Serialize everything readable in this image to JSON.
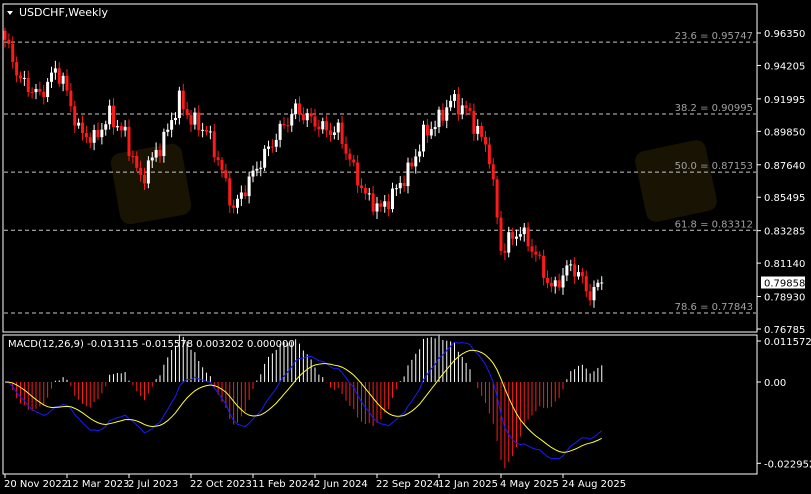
{
  "header": {
    "symbol_timeframe": "USDCHF,Weekly"
  },
  "colors": {
    "bull": "#ffffff",
    "bear": "#ff1a1a",
    "macd_line": "#1a1aff",
    "signal_line": "#ffff33",
    "grid": "#c8c8c8",
    "fib_text": "#a0a0a0"
  },
  "price_axis": {
    "labels": [
      "0.96350",
      "0.94205",
      "0.91995",
      "0.89850",
      "0.87640",
      "0.85495",
      "0.83285",
      "0.81140",
      "0.78930",
      "0.76785"
    ],
    "values": [
      0.9635,
      0.94205,
      0.91995,
      0.8985,
      0.8764,
      0.85495,
      0.83285,
      0.8114,
      0.7893,
      0.76785
    ],
    "current_price": "0.79858"
  },
  "fibonacci": [
    {
      "label": "23.6 = 0.95747",
      "value": 0.95747
    },
    {
      "label": "38.2 = 0.90995",
      "value": 0.90995
    },
    {
      "label": "50.0 = 0.87153",
      "value": 0.87153
    },
    {
      "label": "61.8 = 0.83312",
      "value": 0.83312
    },
    {
      "label": "78.6 = 0.77843",
      "value": 0.77843
    }
  ],
  "macd": {
    "title": "MACD(12,26,9) -0.013115 -0.015578 0.003202 0.000000",
    "axis_labels": [
      "0.011572",
      "0.00",
      "-0.022952"
    ],
    "axis_values": [
      0.011572,
      0,
      -0.022952
    ]
  },
  "time_axis": [
    "20 Nov 2022",
    "12 Mar 2023",
    "2 Jul 2023",
    "22 Oct 2023",
    "11 Feb 2024",
    "2 Jun 2024",
    "22 Sep 2024",
    "12 Jan 2025",
    "4 May 2025",
    "24 Aug 2025"
  ],
  "chart_data": {
    "type": "candlestick",
    "title": "USDCHF,Weekly",
    "ylim": [
      0.76785,
      0.9635
    ],
    "weeks": 155,
    "close_waypoints": [
      [
        0,
        0.959
      ],
      [
        4,
        0.932
      ],
      [
        9,
        0.922
      ],
      [
        13,
        0.939
      ],
      [
        15,
        0.932
      ],
      [
        19,
        0.899
      ],
      [
        23,
        0.893
      ],
      [
        27,
        0.909
      ],
      [
        31,
        0.896
      ],
      [
        35,
        0.866
      ],
      [
        37,
        0.876
      ],
      [
        41,
        0.893
      ],
      [
        45,
        0.919
      ],
      [
        48,
        0.906
      ],
      [
        52,
        0.899
      ],
      [
        55,
        0.88
      ],
      [
        59,
        0.847
      ],
      [
        63,
        0.866
      ],
      [
        67,
        0.883
      ],
      [
        71,
        0.899
      ],
      [
        75,
        0.913
      ],
      [
        79,
        0.906
      ],
      [
        83,
        0.899
      ],
      [
        86,
        0.899
      ],
      [
        90,
        0.873
      ],
      [
        93,
        0.856
      ],
      [
        97,
        0.847
      ],
      [
        101,
        0.86
      ],
      [
        105,
        0.876
      ],
      [
        108,
        0.896
      ],
      [
        112,
        0.906
      ],
      [
        115,
        0.919
      ],
      [
        119,
        0.913
      ],
      [
        122,
        0.899
      ],
      [
        125,
        0.883
      ],
      [
        128,
        0.82
      ],
      [
        130,
        0.826
      ],
      [
        133,
        0.833
      ],
      [
        137,
        0.817
      ],
      [
        141,
        0.794
      ],
      [
        143,
        0.8
      ],
      [
        146,
        0.81
      ],
      [
        148,
        0.804
      ],
      [
        151,
        0.79
      ],
      [
        154,
        0.7986
      ]
    ]
  }
}
